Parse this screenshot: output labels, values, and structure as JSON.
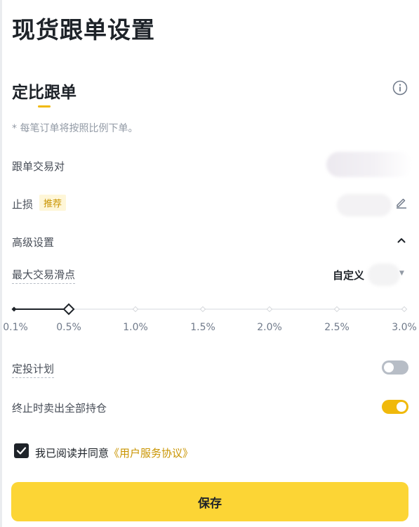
{
  "page": {
    "title": "现货跟单设置"
  },
  "section": {
    "title": "定比跟单",
    "note": "* 每笔订单将按照比例下单。"
  },
  "fields": {
    "pair_label": "跟单交易对",
    "stop_loss_label": "止损",
    "stop_loss_badge": "推荐",
    "advanced_label": "高级设置",
    "slippage_label": "最大交易滑点",
    "slippage_mode": "自定义"
  },
  "slider": {
    "ticks": [
      "0.1%",
      "0.5%",
      "1.0%",
      "1.5%",
      "2.0%",
      "2.5%",
      "3.0%"
    ],
    "selected_value": "0.5%",
    "accent_color": "#1e2329"
  },
  "toggles": {
    "dca_label": "定投计划",
    "dca_on": false,
    "sell_all_label": "终止时卖出全部持仓",
    "sell_all_on": true
  },
  "agreement": {
    "checked": true,
    "text": "我已阅读并同意",
    "link": "《用户服务协议》"
  },
  "actions": {
    "save_label": "保存"
  },
  "colors": {
    "accent": "#f0b90b",
    "button": "#fcd535",
    "link": "#c99400"
  },
  "icons": [
    "info-icon",
    "edit-icon",
    "chevron-up-icon",
    "dropdown-caret-icon",
    "check-icon"
  ]
}
